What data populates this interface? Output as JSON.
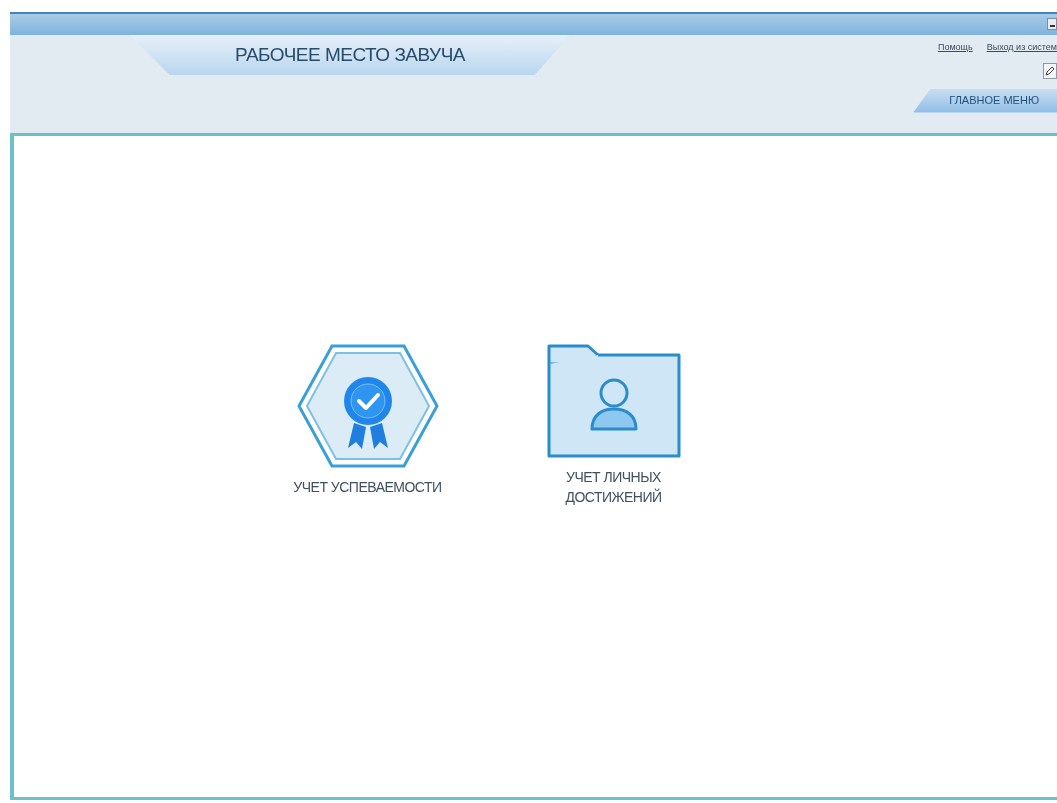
{
  "header": {
    "title": "РАБОЧЕЕ МЕСТО ЗАВУЧА",
    "links": [
      "Помощь",
      "Выход из систем"
    ]
  },
  "tabs": [
    {
      "label": "ГЛАВНОЕ МЕНЮ",
      "selected": true
    }
  ],
  "tiles": [
    {
      "label": "УЧЕТ УСПЕВАЕМОСТИ"
    },
    {
      "label": "УЧЕТ ЛИЧНЫХ ДОСТИЖЕНИЙ"
    }
  ]
}
